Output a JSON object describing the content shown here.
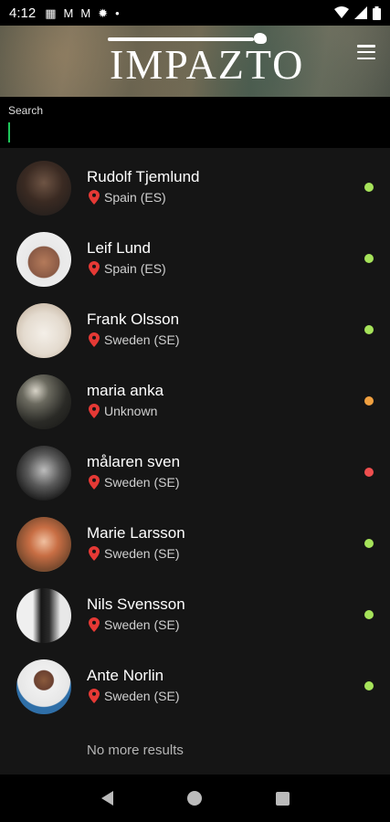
{
  "status_bar": {
    "time": "4:12",
    "icons": [
      "calendar-icon",
      "gmail-icon",
      "gmail-icon",
      "settings-icon",
      "dot-icon"
    ],
    "right_icons": [
      "wifi-icon",
      "signal-icon",
      "battery-icon"
    ]
  },
  "header": {
    "logo_text": "IMPAZTO",
    "menu_icon": "hamburger-menu-icon"
  },
  "search": {
    "label": "Search",
    "value": "",
    "placeholder": ""
  },
  "users": [
    {
      "name": "Rudolf Tjemlund",
      "location": "Spain (ES)",
      "status_color": "#a6e35a"
    },
    {
      "name": "Leif Lund",
      "location": "Spain (ES)",
      "status_color": "#a6e35a"
    },
    {
      "name": "Frank Olsson",
      "location": "Sweden (SE)",
      "status_color": "#a6e35a"
    },
    {
      "name": "maria anka",
      "location": "Unknown",
      "status_color": "#f0a040"
    },
    {
      "name": "målaren sven",
      "location": "Sweden (SE)",
      "status_color": "#ef4f4f"
    },
    {
      "name": "Marie Larsson",
      "location": "Sweden (SE)",
      "status_color": "#a6e35a"
    },
    {
      "name": "Nils Svensson",
      "location": "Sweden (SE)",
      "status_color": "#a6e35a"
    },
    {
      "name": "Ante Norlin",
      "location": "Sweden (SE)",
      "status_color": "#a6e35a"
    }
  ],
  "footer_text": "No more results",
  "colors": {
    "accent": "#1ec55a",
    "pin": "#e53935",
    "background": "#151515"
  }
}
